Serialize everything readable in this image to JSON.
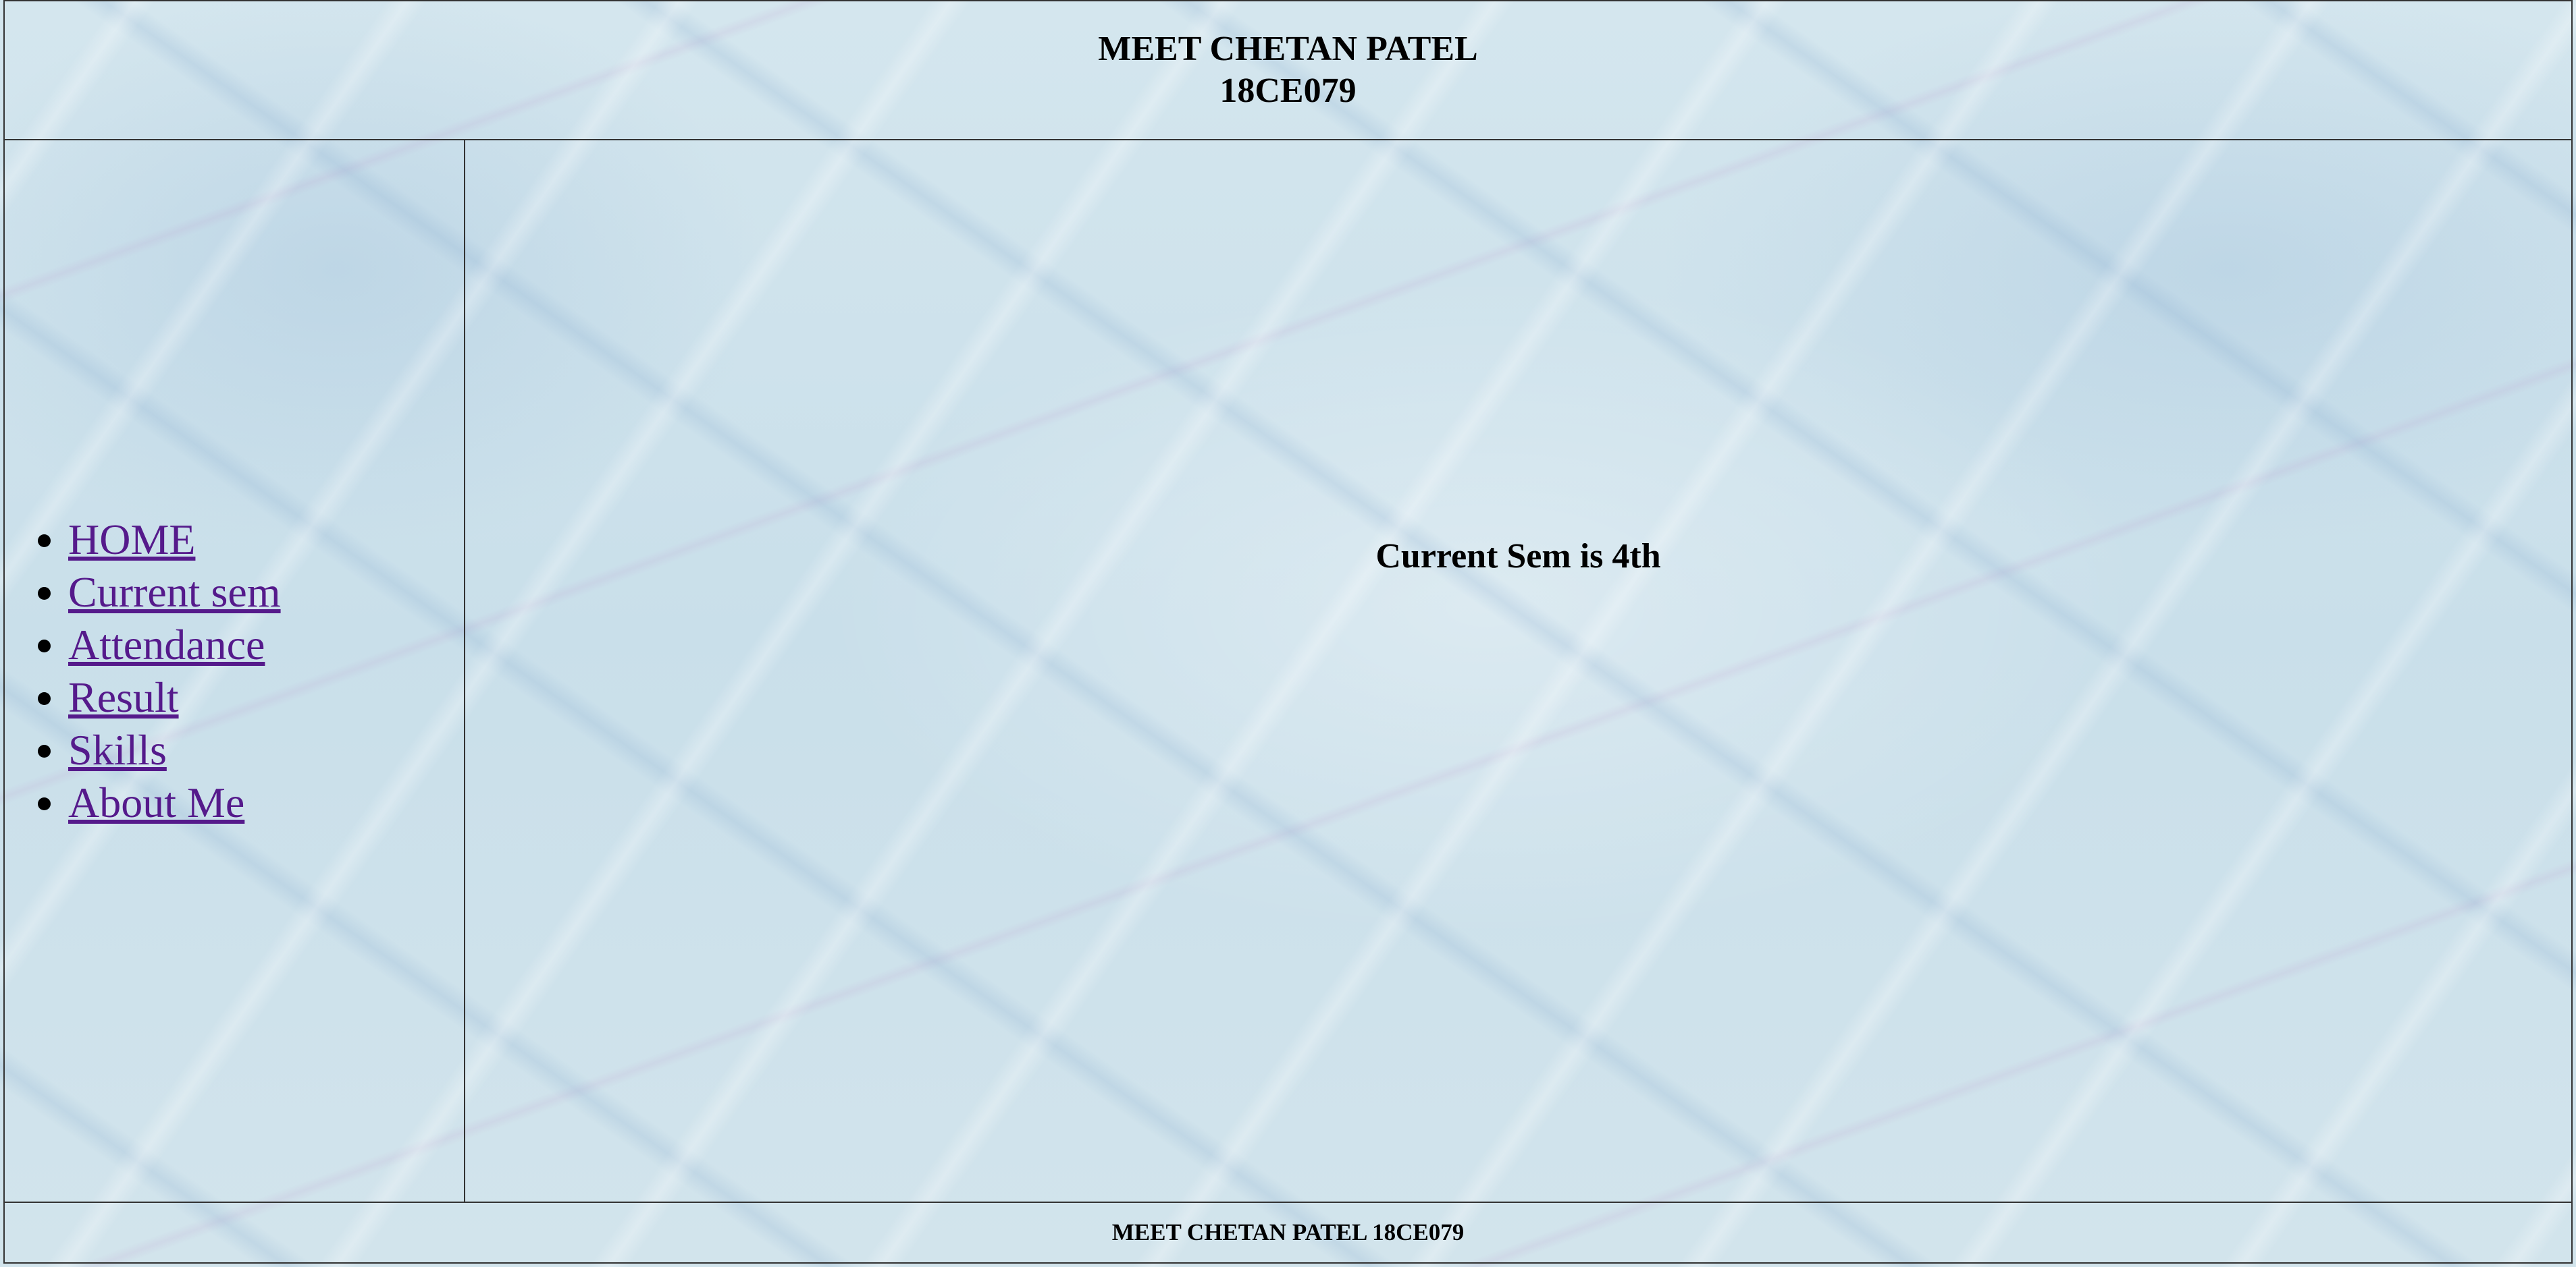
{
  "header": {
    "name": "MEET CHETAN PATEL",
    "id": "18CE079"
  },
  "sidebar": {
    "items": [
      {
        "label": "HOME"
      },
      {
        "label": "Current sem"
      },
      {
        "label": "Attendance"
      },
      {
        "label": "Result"
      },
      {
        "label": "Skills"
      },
      {
        "label": "About Me"
      }
    ]
  },
  "main": {
    "text": "Current Sem is 4th"
  },
  "footer": {
    "text": "MEET CHETAN PATEL 18CE079"
  },
  "colors": {
    "link_visited": "#551a8b",
    "border": "#333333",
    "background": "#cfe3ec"
  }
}
